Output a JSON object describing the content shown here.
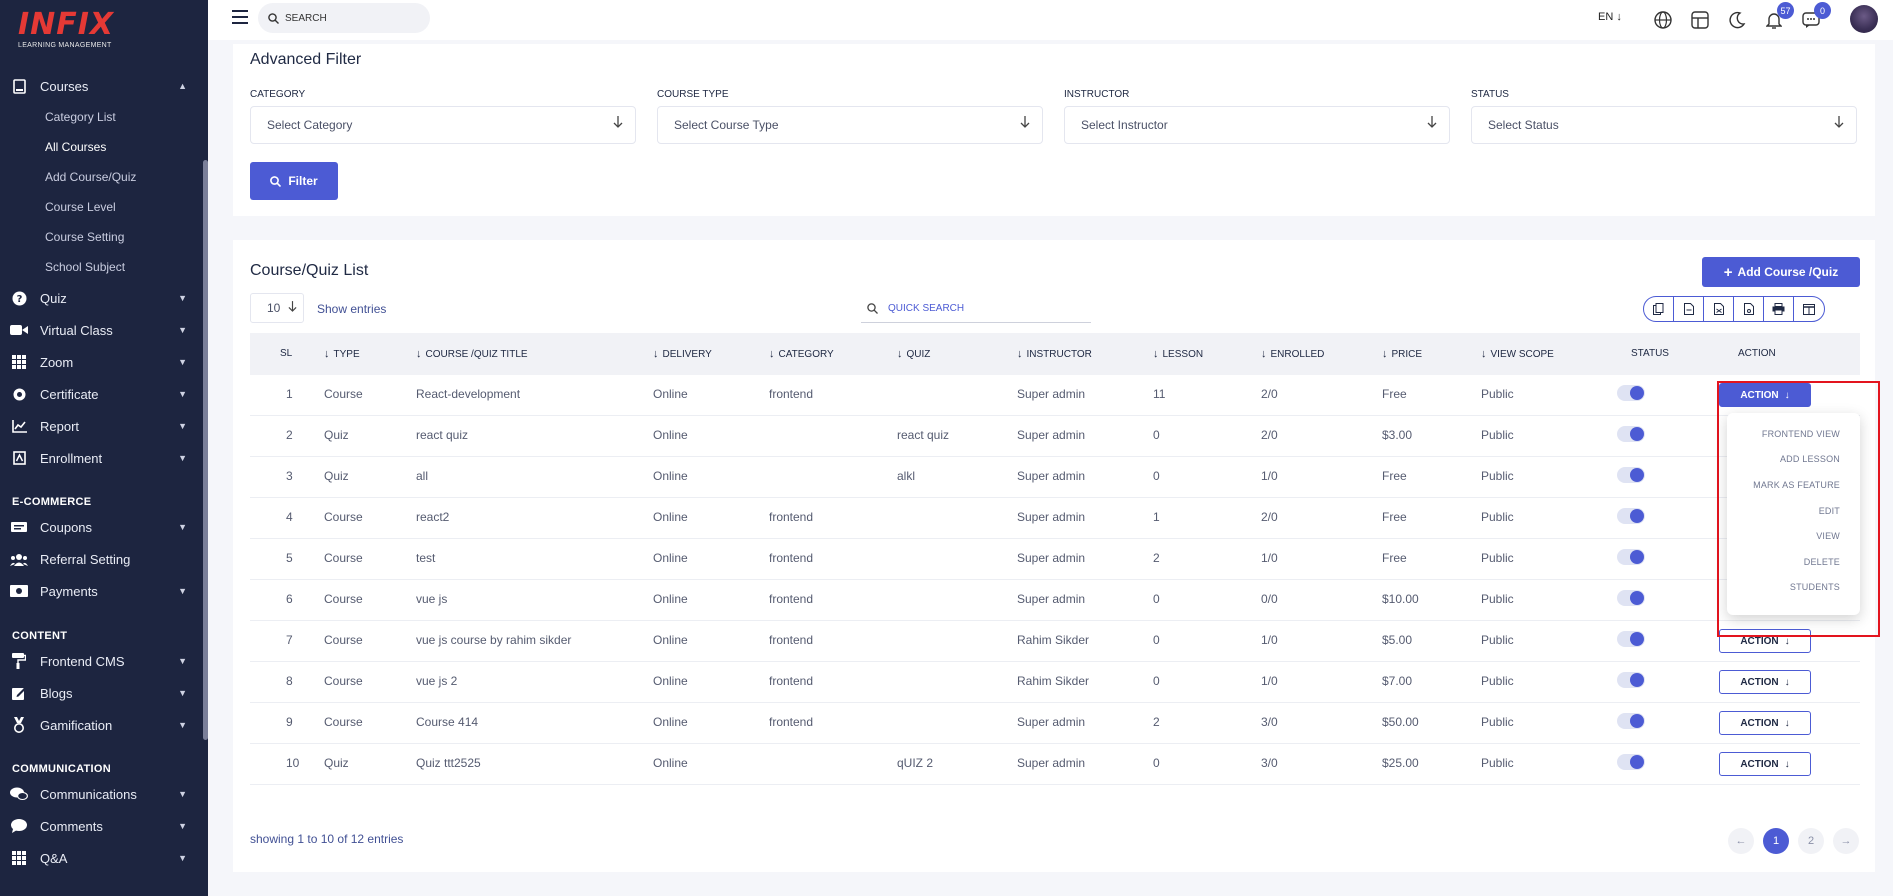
{
  "brand": {
    "name": "INFIX",
    "tagline": "LEARNING MANAGEMENT"
  },
  "topbar": {
    "search_placeholder": "SEARCH",
    "language": "EN",
    "notifications_count": "57",
    "messages_count": "0"
  },
  "sidebar": {
    "courses": {
      "label": "Courses",
      "children": [
        "Category List",
        "All Courses",
        "Add Course/Quiz",
        "Course Level",
        "Course Setting",
        "School Subject"
      ]
    },
    "main_items": [
      "Quiz",
      "Virtual Class",
      "Zoom",
      "Certificate",
      "Report",
      "Enrollment"
    ],
    "ecommerce_label": "E-COMMERCE",
    "ecommerce_items": [
      "Coupons",
      "Referral Setting",
      "Payments"
    ],
    "content_label": "CONTENT",
    "content_items": [
      "Frontend CMS",
      "Blogs",
      "Gamification"
    ],
    "communication_label": "COMMUNICATION",
    "communication_items": [
      "Communications",
      "Comments",
      "Q&A"
    ]
  },
  "filter": {
    "title": "Advanced Filter",
    "category_label": "CATEGORY",
    "category_value": "Select Category",
    "course_type_label": "COURSE TYPE",
    "course_type_value": "Select Course Type",
    "instructor_label": "INSTRUCTOR",
    "instructor_value": "Select Instructor",
    "status_label": "STATUS",
    "status_value": "Select Status",
    "button": "Filter"
  },
  "list": {
    "title": "Course/Quiz List",
    "add_button": "Add Course /Quiz",
    "entries_value": "10",
    "show_entries": "Show entries",
    "quick_search_placeholder": "QUICK SEARCH",
    "showing": "showing 1 to 10 of 12 entries",
    "columns": [
      "SL",
      "TYPE",
      "COURSE /QUIZ TITLE",
      "DELIVERY",
      "CATEGORY",
      "QUIZ",
      "INSTRUCTOR",
      "LESSON",
      "ENROLLED",
      "PRICE",
      "VIEW SCOPE",
      "STATUS",
      "ACTION"
    ],
    "action_label": "ACTION",
    "rows": [
      {
        "sl": "1",
        "type": "Course",
        "title": "React-development",
        "delivery": "Online",
        "category": "frontend",
        "quiz": "",
        "instructor": "Super admin",
        "lesson": "11",
        "enrolled": "2/0",
        "price": "Free",
        "scope": "Public"
      },
      {
        "sl": "2",
        "type": "Quiz",
        "title": "react quiz",
        "delivery": "Online",
        "category": "",
        "quiz": "react quiz",
        "instructor": "Super admin",
        "lesson": "0",
        "enrolled": "2/0",
        "price": "$3.00",
        "scope": "Public"
      },
      {
        "sl": "3",
        "type": "Quiz",
        "title": "all",
        "delivery": "Online",
        "category": "",
        "quiz": "alkl",
        "instructor": "Super admin",
        "lesson": "0",
        "enrolled": "1/0",
        "price": "Free",
        "scope": "Public"
      },
      {
        "sl": "4",
        "type": "Course",
        "title": "react2",
        "delivery": "Online",
        "category": "frontend",
        "quiz": "",
        "instructor": "Super admin",
        "lesson": "1",
        "enrolled": "2/0",
        "price": "Free",
        "scope": "Public"
      },
      {
        "sl": "5",
        "type": "Course",
        "title": "test",
        "delivery": "Online",
        "category": "frontend",
        "quiz": "",
        "instructor": "Super admin",
        "lesson": "2",
        "enrolled": "1/0",
        "price": "Free",
        "scope": "Public"
      },
      {
        "sl": "6",
        "type": "Course",
        "title": "vue js",
        "delivery": "Online",
        "category": "frontend",
        "quiz": "",
        "instructor": "Super admin",
        "lesson": "0",
        "enrolled": "0/0",
        "price": "$10.00",
        "scope": "Public"
      },
      {
        "sl": "7",
        "type": "Course",
        "title": "vue js course by rahim sikder",
        "delivery": "Online",
        "category": "frontend",
        "quiz": "",
        "instructor": "Rahim Sikder",
        "lesson": "0",
        "enrolled": "1/0",
        "price": "$5.00",
        "scope": "Public"
      },
      {
        "sl": "8",
        "type": "Course",
        "title": "vue js 2",
        "delivery": "Online",
        "category": "frontend",
        "quiz": "",
        "instructor": "Rahim Sikder",
        "lesson": "0",
        "enrolled": "1/0",
        "price": "$7.00",
        "scope": "Public"
      },
      {
        "sl": "9",
        "type": "Course",
        "title": "Course 414",
        "delivery": "Online",
        "category": "frontend",
        "quiz": "",
        "instructor": "Super admin",
        "lesson": "2",
        "enrolled": "3/0",
        "price": "$50.00",
        "scope": "Public"
      },
      {
        "sl": "10",
        "type": "Quiz",
        "title": "Quiz ttt2525",
        "delivery": "Online",
        "category": "",
        "quiz": "qUIZ 2",
        "instructor": "Super admin",
        "lesson": "0",
        "enrolled": "3/0",
        "price": "$25.00",
        "scope": "Public"
      }
    ],
    "action_menu": [
      "FRONTEND VIEW",
      "ADD LESSON",
      "MARK AS FEATURE",
      "EDIT",
      "VIEW",
      "DELETE",
      "STUDENTS"
    ],
    "pages": [
      "1",
      "2"
    ]
  },
  "colors": {
    "accent": "#4c5bd4",
    "sidebar": "#1d2540",
    "brand_red": "#e53935",
    "highlight": "#e3141e"
  }
}
